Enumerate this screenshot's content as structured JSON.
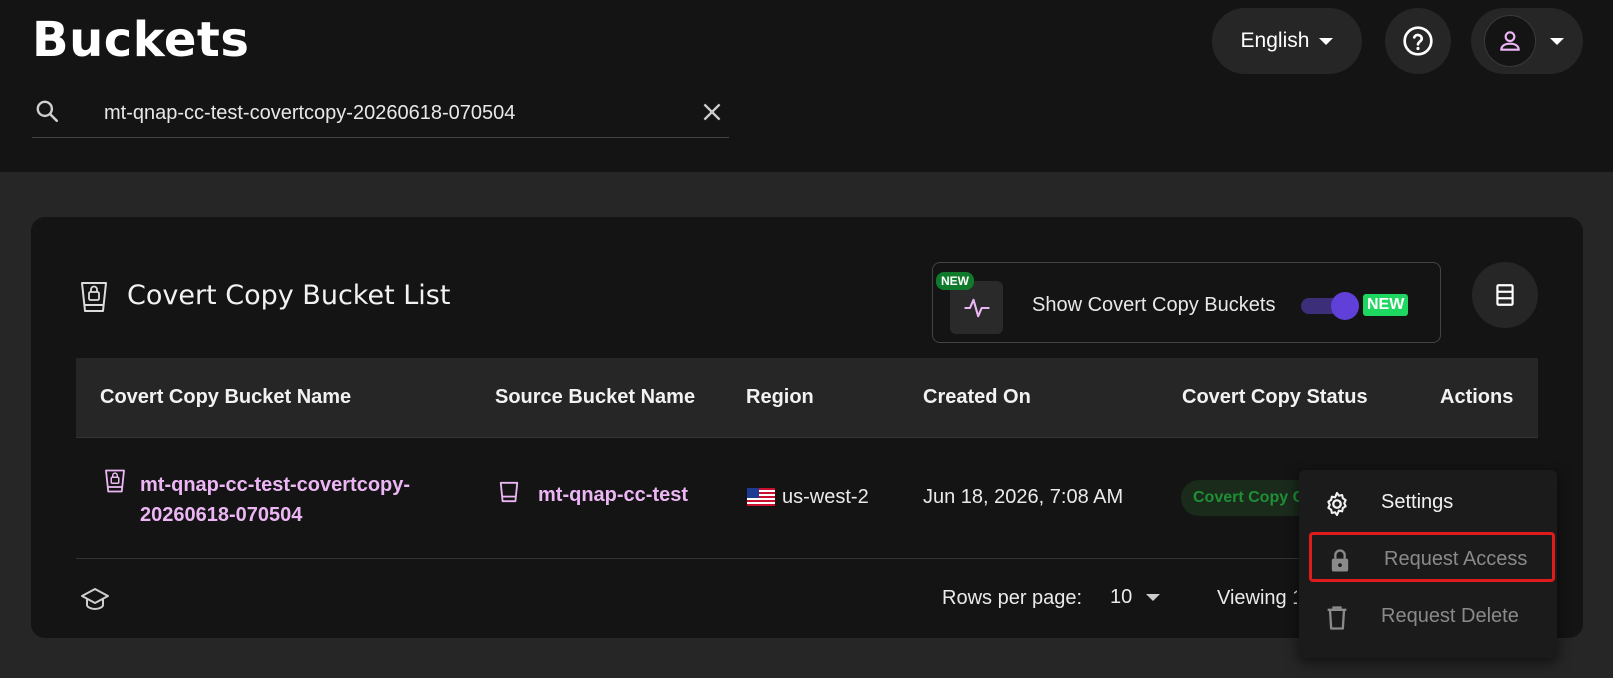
{
  "header": {
    "title": "Buckets",
    "search": {
      "value": "mt-qnap-cc-test-covertcopy-20260618-070504",
      "icon": "search-icon",
      "clear_icon": "close-icon"
    },
    "language": "English",
    "help_icon": "help-circle-icon",
    "user_icon": "user-icon"
  },
  "card": {
    "title": "Covert Copy Bucket List",
    "title_icon": "locked-bucket-icon",
    "toggle": {
      "badge": "NEW",
      "label": "Show Covert Copy Buckets",
      "enabled": true,
      "new_tag": "NEW",
      "icon": "activity-icon"
    },
    "columns_icon": "columns-icon"
  },
  "table": {
    "columns": [
      "Covert Copy Bucket Name",
      "Source Bucket Name",
      "Region",
      "Created On",
      "Covert Copy Status",
      "Actions"
    ],
    "rows": [
      {
        "name_line1": "mt-qnap-cc-test-covertcopy-",
        "name_line2": "20260618-070504",
        "source": "mt-qnap-cc-test",
        "region": "us-west-2",
        "region_flag": "us-flag-icon",
        "created": "Jun 18, 2026, 7:08 AM",
        "status": "Covert Copy Created"
      }
    ]
  },
  "footer": {
    "academy_icon": "graduation-cap-icon",
    "rows_per_page_label": "Rows per page:",
    "rows_per_page": "10",
    "viewing": "Viewing 1-1 of 1"
  },
  "actions_menu": {
    "items": [
      {
        "label": "Settings",
        "icon": "gear-icon",
        "enabled": true
      },
      {
        "label": "Request Access",
        "icon": "lock-icon",
        "enabled": false,
        "highlighted": true
      },
      {
        "label": "Request Delete",
        "icon": "trash-icon",
        "enabled": false
      }
    ]
  },
  "colors": {
    "accent": "#ecb6f5",
    "toggle": "#6040d8",
    "new_badge": "#1ed760",
    "highlight": "#e01b1b"
  }
}
